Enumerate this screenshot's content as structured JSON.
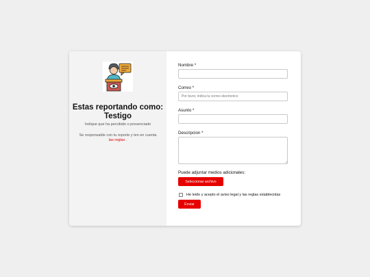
{
  "intro": {
    "title": "Estas reportando como: Testigo",
    "subtitle": "Indique que ha percibido o presenciado",
    "note_prefix": "Se responsable con tu reporte y ten en cuenta",
    "note_link": "las reglas",
    "note_suffix": "."
  },
  "form": {
    "nombre_label": "Nombre *",
    "correo_label": "Correo *",
    "correo_placeholder": "Por favor, indica tu correo electronico",
    "asunto_label": "Asunto *",
    "descripcion_label": "Descripcion *",
    "attach_label": "Puede adjuntar medios adicionales:",
    "attach_button": "Seleccionar archivo",
    "consent_label": "He leido y acepto el aviso legal y las reglas establecidas",
    "submit_button": "Enviar"
  },
  "colors": {
    "accent": "#e60000",
    "link": "#e00000"
  },
  "icons": {
    "illustration": "witness-reporter-icon",
    "textarea_resize": "resize-grip-icon"
  }
}
